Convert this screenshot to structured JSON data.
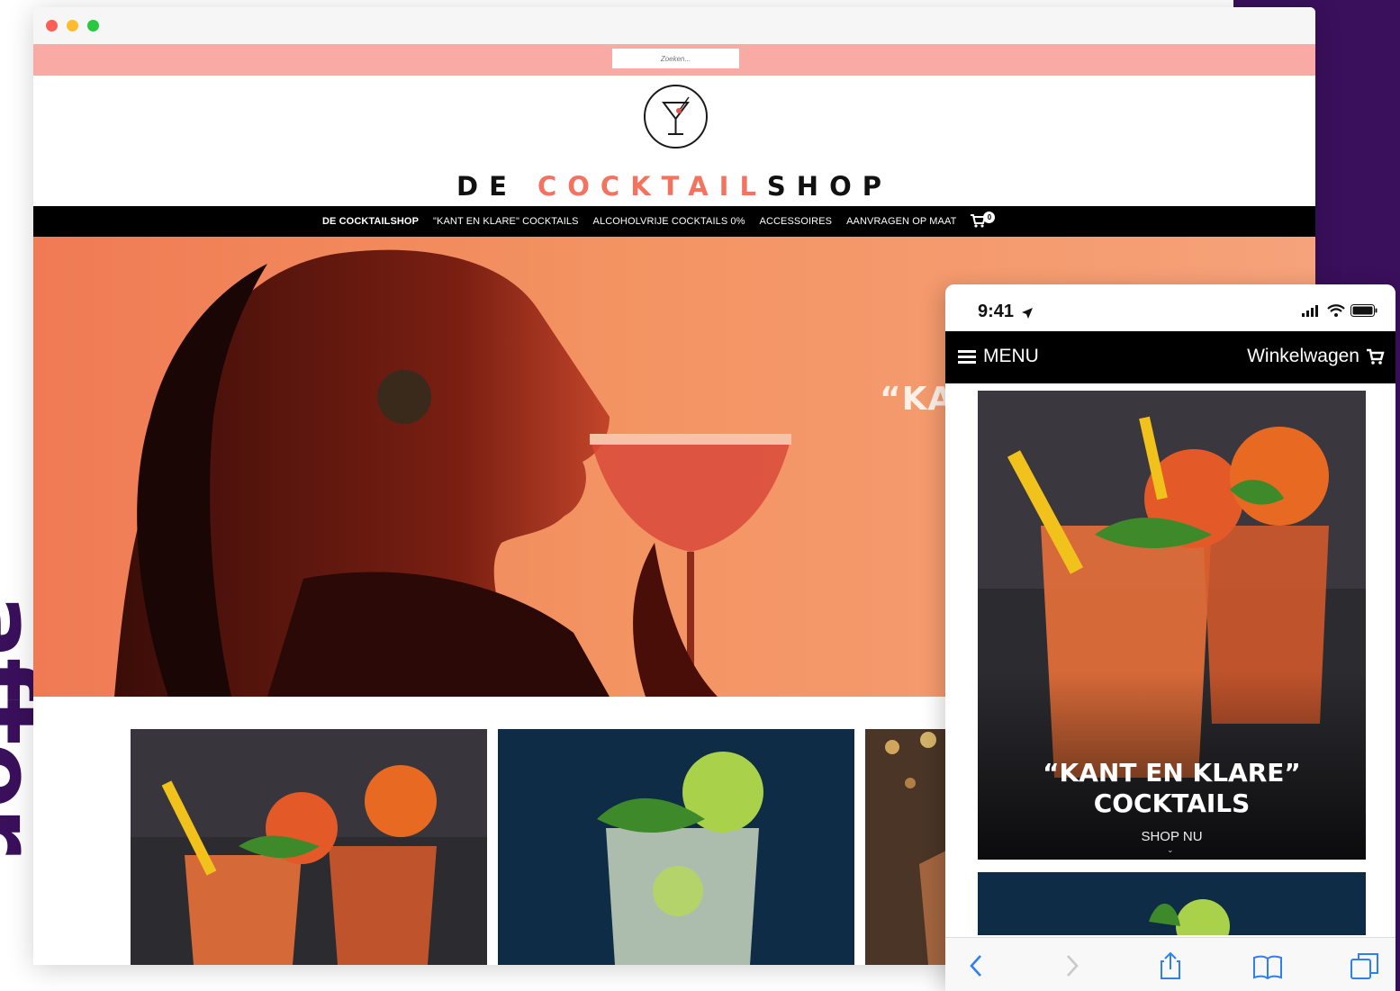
{
  "colors": {
    "purple": "#3a0f5c",
    "pink_bar": "#f9aaa4",
    "brand_accent": "#f3735f",
    "nav_bg": "#000000",
    "hero_orange": "#f39362"
  },
  "side_word": "after",
  "browser": {
    "search": {
      "placeholder": "Zoeken..."
    },
    "brand": {
      "part1": "DE ",
      "part2": "COCKTAIL",
      "part3": "SHOP"
    },
    "nav": {
      "items": [
        {
          "label": "DE COCKTAILSHOP",
          "active": true
        },
        {
          "label": "\"KANT EN KLARE\" COCKTAILS",
          "active": false
        },
        {
          "label": "ALCOHOLVRIJE COCKTAILS 0%",
          "active": false
        },
        {
          "label": "ACCESSOIRES",
          "active": false
        },
        {
          "label": "AANVRAGEN OP MAAT",
          "active": false
        }
      ],
      "cart_count": "0",
      "cart_icon": "cart-icon"
    },
    "hero": {
      "text": "“KA"
    }
  },
  "phone": {
    "time": "9:41",
    "menu_label": "MENU",
    "cart_label": "Winkelwagen",
    "card": {
      "title_line1": "“KANT EN KLARE”",
      "title_line2": "COCKTAILS",
      "cta": "SHOP NU"
    },
    "toolbar_icons": [
      "back-icon",
      "forward-icon",
      "share-icon",
      "bookmarks-icon",
      "tabs-icon"
    ]
  }
}
